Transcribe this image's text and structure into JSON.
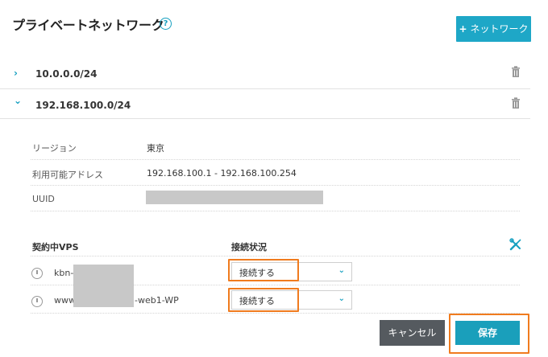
{
  "page": {
    "title": "プライベートネットワーク",
    "help_glyph": "?",
    "add_button": {
      "icon": "+",
      "label": "ネットワーク"
    }
  },
  "networks": [
    {
      "cidr": "10.0.0.0/24",
      "expanded": false,
      "chevron": "›"
    },
    {
      "cidr": "192.168.100.0/24",
      "expanded": true,
      "chevron": "⌄"
    }
  ],
  "details": {
    "region_label": "リージョン",
    "region_value": "東京",
    "range_label": "利用可能アドレス",
    "range_value": "192.168.100.1 - 192.168.100.254",
    "uuid_label": "UUID"
  },
  "vps_table": {
    "col_vps": "契約中VPS",
    "col_status": "接続状況",
    "rows": [
      {
        "name_prefix": "kbn-y",
        "name_suffix": "",
        "status": "接続する"
      },
      {
        "name_prefix": "www",
        "name_suffix": "-web1-WP",
        "status": "接続する"
      }
    ]
  },
  "actions": {
    "cancel": "キャンセル",
    "save": "保存"
  },
  "colors": {
    "accent": "#1ea7c7",
    "highlight": "#f07b1e",
    "cancel": "#555a5f"
  }
}
